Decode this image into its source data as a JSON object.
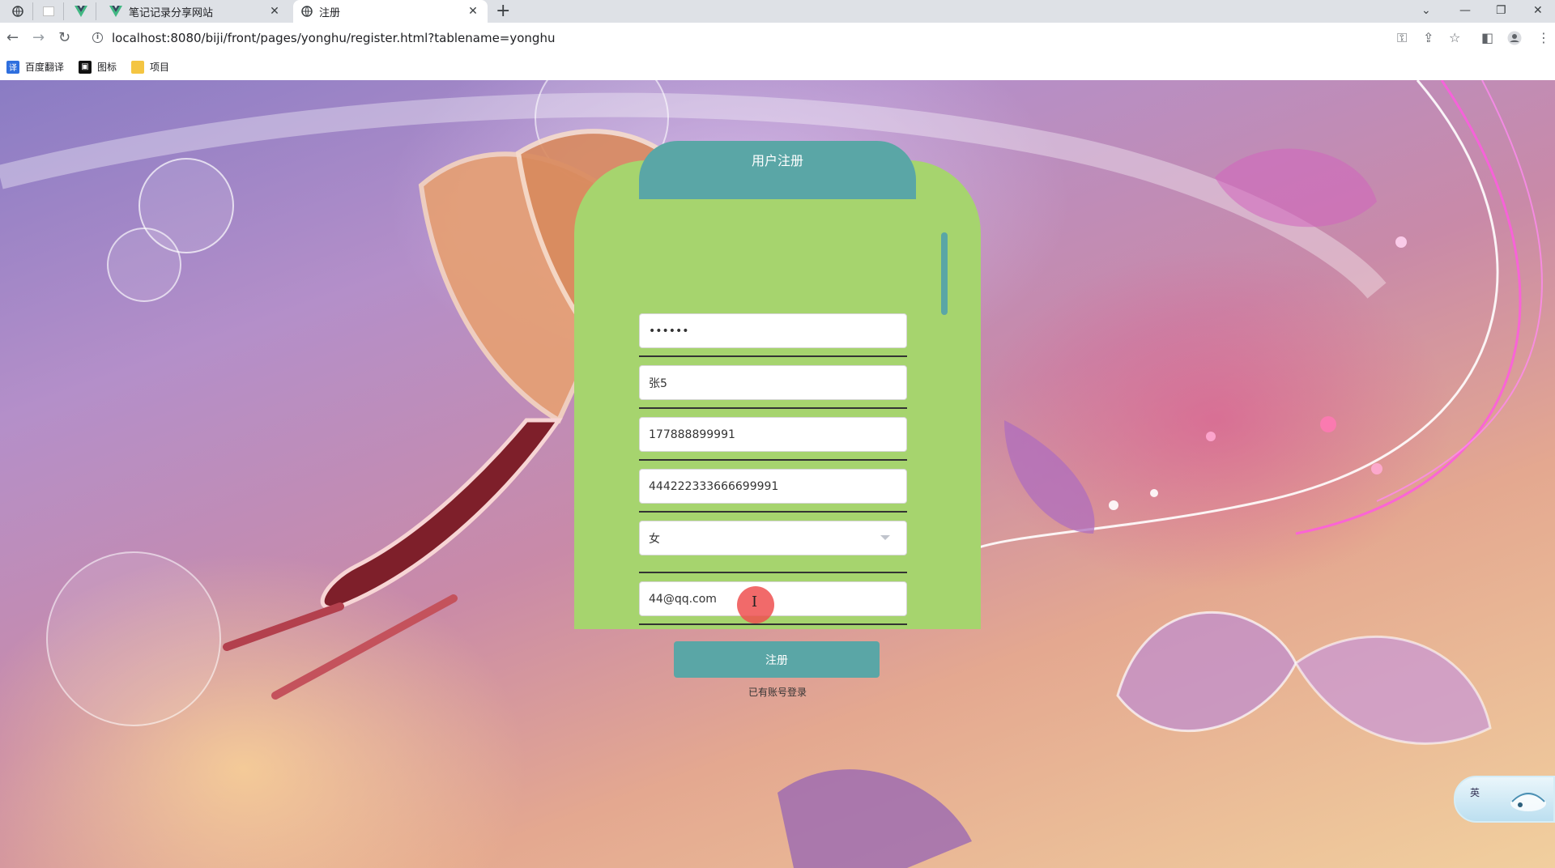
{
  "browser": {
    "tabs": [
      {
        "title": "笔记记录分享网站",
        "active": false
      },
      {
        "title": "注册",
        "active": true
      }
    ],
    "url": "localhost:8080/biji/front/pages/yonghu/register.html?tablename=yonghu",
    "bookmarks": [
      {
        "label": "百度翻译",
        "icon": "translate-icon"
      },
      {
        "label": "图标",
        "icon": "image-icon"
      },
      {
        "label": "项目",
        "icon": "folder-icon"
      }
    ]
  },
  "form": {
    "title": "用户注册",
    "fields": {
      "password": "••••••",
      "name": "张5",
      "phone": "177888899991",
      "id_number": "444222333666699991",
      "gender": "女",
      "email": "44@qq.com"
    },
    "submit_label": "注册",
    "login_link": "已有账号登录"
  },
  "ime": {
    "label": "英"
  },
  "colors": {
    "card_bg": "#a6d46e",
    "accent": "#5aa6a6"
  }
}
